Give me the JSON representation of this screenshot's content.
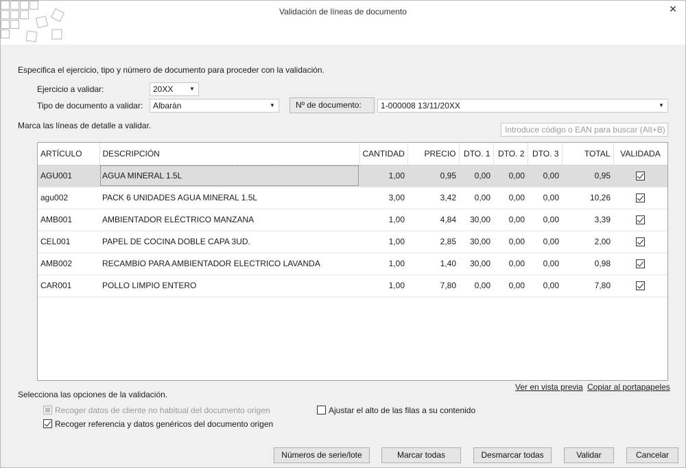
{
  "window": {
    "title": "Validación de líneas de documento",
    "close_glyph": "✕"
  },
  "instructions": {
    "top": "Especifica el ejercicio, tipo y número de documento para proceder con la validación.",
    "lines": "Marca las líneas de detalle a validar.",
    "options": "Selecciona las opciones de la validación."
  },
  "form": {
    "ejercicio_label": "Ejercicio a validar:",
    "ejercicio_value": "20XX",
    "tipo_label": "Tipo de documento a validar:",
    "tipo_value": "Albarán",
    "documento_label": "Nº de documento:",
    "documento_value": "1-000008   13/11/20XX",
    "search_placeholder": "Introduce código o EAN para buscar (Alt+B)"
  },
  "table": {
    "headers": [
      "ARTÍCULO",
      "DESCRIPCIÓN",
      "CANTIDAD",
      "PRECIO",
      "DTO. 1",
      "DTO. 2",
      "DTO. 3",
      "TOTAL",
      "VALIDADA"
    ],
    "rows": [
      {
        "articulo": "AGU001",
        "descripcion": "AGUA MINERAL 1.5L",
        "cantidad": "1,00",
        "precio": "0,95",
        "dto1": "0,00",
        "dto2": "0,00",
        "dto3": "0,00",
        "total": "0,95",
        "validada": true
      },
      {
        "articulo": "agu002",
        "descripcion": "PACK 6 UNIDADES AGUA MINERAL 1.5L",
        "cantidad": "3,00",
        "precio": "3,42",
        "dto1": "0,00",
        "dto2": "0,00",
        "dto3": "0,00",
        "total": "10,26",
        "validada": true
      },
      {
        "articulo": "AMB001",
        "descripcion": "AMBIENTADOR ELÉCTRICO MANZANA",
        "cantidad": "1,00",
        "precio": "4,84",
        "dto1": "30,00",
        "dto2": "0,00",
        "dto3": "0,00",
        "total": "3,39",
        "validada": true
      },
      {
        "articulo": "CEL001",
        "descripcion": "PAPEL DE COCINA DOBLE CAPA 3UD.",
        "cantidad": "1,00",
        "precio": "2,85",
        "dto1": "30,00",
        "dto2": "0,00",
        "dto3": "0,00",
        "total": "2,00",
        "validada": true
      },
      {
        "articulo": "AMB002",
        "descripcion": "RECAMBIO PARA AMBIENTADOR ELECTRICO LAVANDA",
        "cantidad": "1,00",
        "precio": "1,40",
        "dto1": "30,00",
        "dto2": "0,00",
        "dto3": "0,00",
        "total": "0,98",
        "validada": true
      },
      {
        "articulo": "CAR001",
        "descripcion": "POLLO LIMPIO ENTERO",
        "cantidad": "1,00",
        "precio": "7,80",
        "dto1": "0,00",
        "dto2": "0,00",
        "dto3": "0,00",
        "total": "7,80",
        "validada": true
      }
    ]
  },
  "links": {
    "preview": "Ver en vista previa",
    "copy": "Copiar al portapapeles"
  },
  "options": {
    "recoger_cliente": "Recoger datos de cliente no habitual del documento origen",
    "recoger_referencia": "Recoger referencia y datos genéricos del documento origen",
    "ajustar_alto": "Ajustar el alto de las filas a su contenido"
  },
  "buttons": {
    "serie": "Números de serie/lote",
    "marcar": "Marcar todas",
    "desmarcar": "Desmarcar todas",
    "validar": "Validar",
    "cancelar": "Cancelar"
  }
}
